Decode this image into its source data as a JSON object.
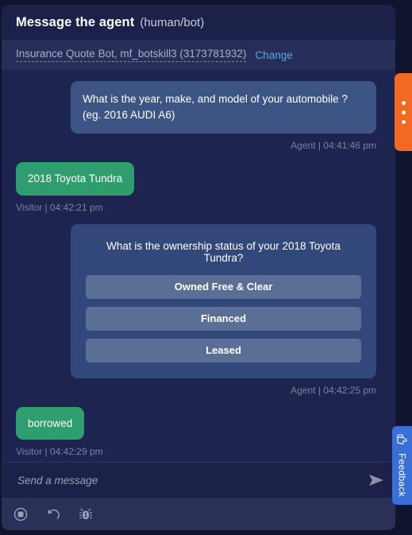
{
  "header": {
    "title": "Message the agent",
    "subtitle": "(human/bot)"
  },
  "bot_selector": {
    "name": "Insurance Quote Bot, mf_botskill3 (3173781932)",
    "change_label": "Change"
  },
  "conversation": [
    {
      "sender": "agent",
      "type": "text",
      "text": "What is the year, make, and model of your automobile ? (eg. 2016 AUDI A6)",
      "meta": "Agent | 04:41:46 pm"
    },
    {
      "sender": "visitor",
      "type": "text",
      "text": "2018 Toyota Tundra",
      "meta": "Visitor | 04:42:21 pm"
    },
    {
      "sender": "agent",
      "type": "options",
      "question": "What is the ownership status of your 2018 Toyota Tundra?",
      "options": [
        "Owned Free & Clear",
        "Financed",
        "Leased"
      ],
      "meta": "Agent | 04:42:25 pm"
    },
    {
      "sender": "visitor",
      "type": "text",
      "text": "borrowed",
      "meta": "Visitor | 04:42:29 pm"
    }
  ],
  "composer": {
    "value": "",
    "placeholder": "Send a message",
    "send_icon": "send-arrow-icon"
  },
  "toolbar": {
    "items": [
      {
        "icon": "stop-record-icon"
      },
      {
        "icon": "undo-icon"
      },
      {
        "icon": "bug-icon"
      }
    ]
  },
  "side_tabs": {
    "drag_handle": {
      "icon": "three-dots-icon"
    },
    "feedback": {
      "label": "Feedback",
      "icon": "thumbs-up-icon"
    }
  },
  "colors": {
    "page_background": "#10142c",
    "panel_background": "#1d2450",
    "agent_bubble": "#3c5585",
    "visitor_bubble": "#2f9e6e",
    "options_card": "#32477a",
    "option_button": "#5a6f96",
    "link": "#58a5e8",
    "orange_tab": "#f26a21",
    "feedback_tab": "#3a6fd8"
  }
}
